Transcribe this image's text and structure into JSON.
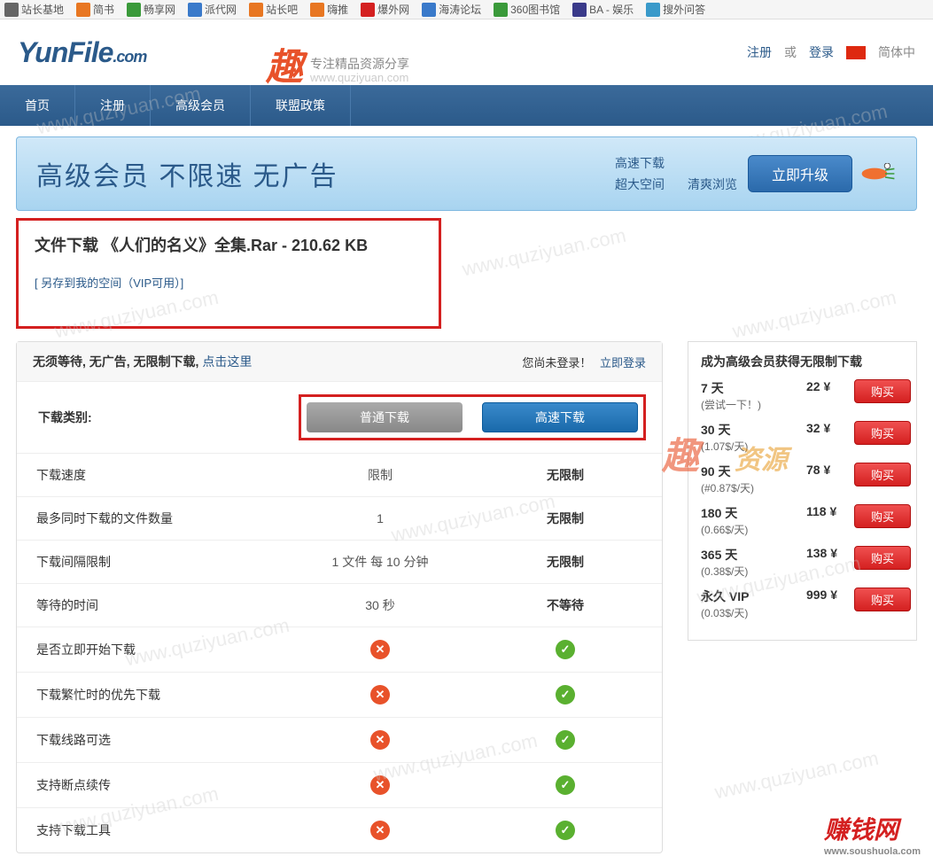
{
  "bookmarks": [
    {
      "label": "站长基地",
      "color": "#666"
    },
    {
      "label": "简书",
      "color": "#e87722"
    },
    {
      "label": "畅享网",
      "color": "#3a9a3a"
    },
    {
      "label": "派代网",
      "color": "#3a7aca"
    },
    {
      "label": "站长吧",
      "color": "#e87722"
    },
    {
      "label": "嗨推",
      "color": "#e87722"
    },
    {
      "label": "爆外网",
      "color": "#d42020"
    },
    {
      "label": "海涛论坛",
      "color": "#3a7aca"
    },
    {
      "label": "360图书馆",
      "color": "#3a9a3a"
    },
    {
      "label": "BA - 娱乐",
      "color": "#3a3a8a"
    },
    {
      "label": "搜外问答",
      "color": "#3a9aca"
    }
  ],
  "logo": {
    "main": "YunFile",
    "suffix": ".com"
  },
  "header": {
    "register": "注册",
    "or": "或",
    "login": "登录",
    "lang": "简体中"
  },
  "nav": [
    "首页",
    "注册",
    "高级会员",
    "联盟政策"
  ],
  "promo": {
    "text": "高级会员   不限速   无广告",
    "features": [
      "高速下载",
      "超大空间",
      "清爽浏览"
    ],
    "upgrade": "立即升级"
  },
  "file": {
    "title": "文件下载  《人们的名义》全集.Rar - 210.62 KB",
    "save_link": "[ 另存到我的空间（VIP可用）]"
  },
  "dl_header": {
    "prefix": "无须等待, 无广告, 无限制下载, ",
    "click": "点击这里",
    "not_logged": "您尚未登录！",
    "login_now": "立即登录"
  },
  "dl_type_label": "下载类别:",
  "btn_normal": "普通下载",
  "btn_fast": "高速下载",
  "features": [
    {
      "label": "下载速度",
      "normal": "限制",
      "fast": "无限制"
    },
    {
      "label": "最多同时下载的文件数量",
      "normal": "1",
      "fast": "无限制"
    },
    {
      "label": "下载间隔限制",
      "normal": "1 文件 每 10 分钟",
      "fast": "无限制"
    },
    {
      "label": "等待的时间",
      "normal": "30 秒",
      "fast": "不等待"
    },
    {
      "label": "是否立即开始下载",
      "normal": "x",
      "fast": "v"
    },
    {
      "label": "下载繁忙时的优先下载",
      "normal": "x",
      "fast": "v"
    },
    {
      "label": "下载线路可选",
      "normal": "x",
      "fast": "v"
    },
    {
      "label": "支持断点续传",
      "normal": "x",
      "fast": "v"
    },
    {
      "label": "支持下载工具",
      "normal": "x",
      "fast": "v"
    }
  ],
  "vip": {
    "title": "成为高级会员获得无限制下载",
    "buy": "购买",
    "plans": [
      {
        "name": "7 天",
        "sub": "(尝试一下！)",
        "price": "22 ¥"
      },
      {
        "name": "30 天",
        "sub": "(1.07$/天)",
        "price": "32 ¥"
      },
      {
        "name": "90 天",
        "sub": "(#0.87$/天)",
        "price": "78 ¥"
      },
      {
        "name": "180 天",
        "sub": "(0.66$/天)",
        "price": "118 ¥"
      },
      {
        "name": "365 天",
        "sub": "(0.38$/天)",
        "price": "138 ¥"
      },
      {
        "name": "永久 VIP",
        "sub": "(0.03$/天)",
        "price": "999 ¥"
      }
    ]
  },
  "watermark_text": "www.quziyuan.com",
  "watermark_sub": "专注精品资源分享",
  "bottom_brand": "赚钱网",
  "bottom_brand_sub": "www.soushuola.com"
}
